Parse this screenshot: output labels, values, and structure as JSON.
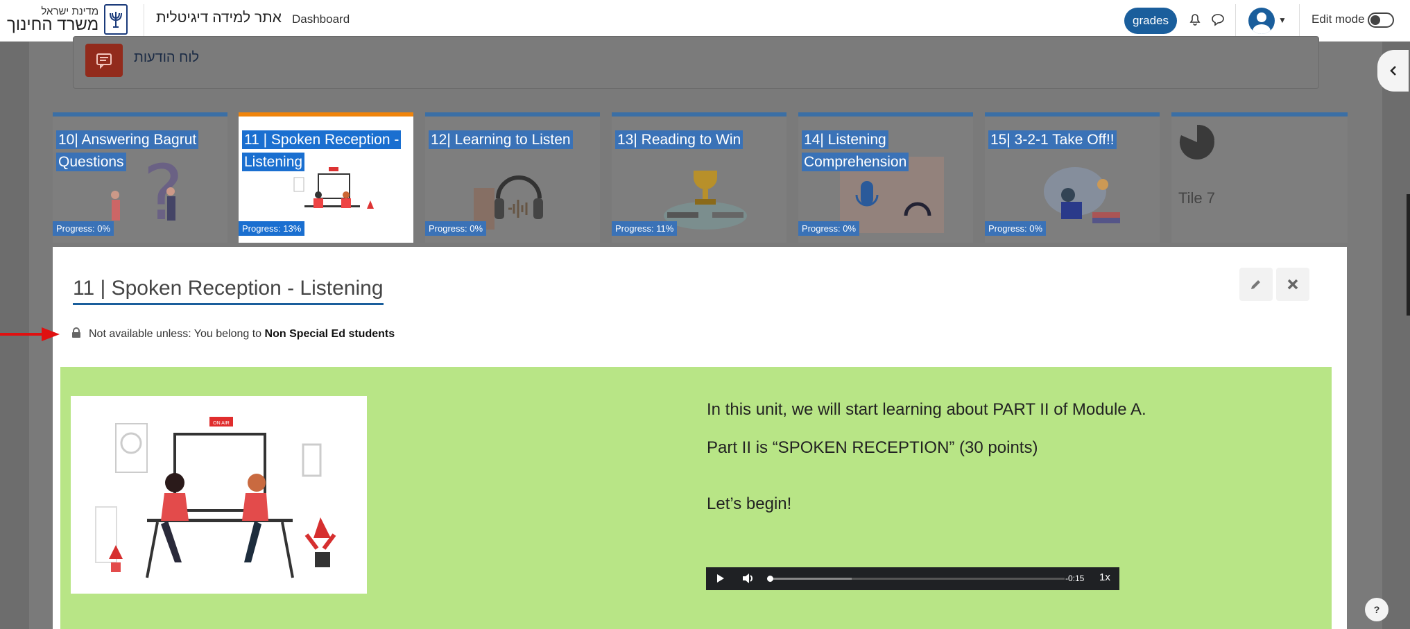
{
  "navbar": {
    "brand_small": "מדינת ישראל",
    "brand_big": "משרד החינוך",
    "site_name": "אתר למידה דיגיטלית",
    "dashboard": "Dashboard",
    "grades": "grades",
    "edit_mode": "Edit mode"
  },
  "forum": {
    "label": "לוח הודעות"
  },
  "tiles": [
    {
      "title": "10| Answering Bagrut Questions",
      "progress": "Progress: 0%"
    },
    {
      "title": "11 | Spoken Reception - Listening",
      "progress": "Progress: 13%"
    },
    {
      "title": "12| Learning to Listen",
      "progress": "Progress: 0%"
    },
    {
      "title": "13| Reading to Win",
      "progress": "Progress: 11%"
    },
    {
      "title": "14| Listening Comprehension",
      "progress": "Progress: 0%"
    },
    {
      "title": "15| 3-2-1 Take Off!!",
      "progress": "Progress: 0%"
    },
    {
      "title": "Tile 7"
    }
  ],
  "section": {
    "title": "11 | Spoken Reception - Listening",
    "restriction_prefix": "Not available unless: You belong to ",
    "restriction_group": "Non Special Ed students",
    "para1": "In this unit, we will start learning about PART II of Module A.",
    "para2": "Part II is “SPOKEN RECEPTION” (30 points)",
    "para3": "Let’s begin!",
    "audio_time": "-0:15",
    "audio_speed": "1x",
    "onair": "ON AIR"
  },
  "help": "?",
  "colors": {
    "accent": "#1a5e9c",
    "active_tile": "#f0840b",
    "green_block": "#b8e586",
    "forum_icon": "#922b1c"
  }
}
